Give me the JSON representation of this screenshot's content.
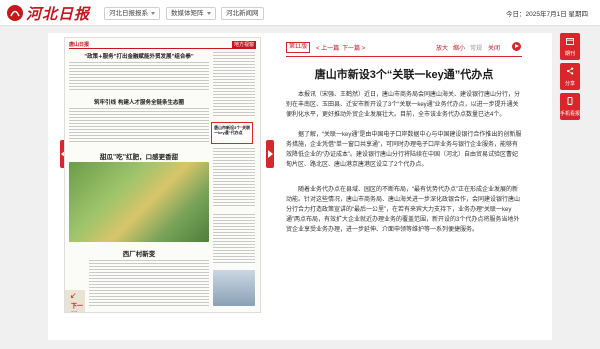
{
  "header": {
    "logo_text": "河北日报",
    "nav": [
      "河北日报报系",
      "数媒体矩阵",
      "河北新闻网"
    ],
    "date": "今日：2025年7月1日 星期四"
  },
  "newspaper": {
    "page_label": "唐山日报",
    "section_tag": "地方视窗",
    "headline_1": "\"政策+服务\"打出金融赋能外贸发展\"组合拳\"",
    "headline_2": "筑牢引线 构建人才服务全链条生态圈",
    "headline_3": "甜瓜\"吃\"红肥，口感更香甜",
    "headline_4": "西厂村新变",
    "highlight_title": "唐山市新设3个\"关联一key通\"代办点",
    "prev_page": "下一版"
  },
  "toolbar": {
    "edition": "第11版",
    "prev": "< 上一篇",
    "next": "下一篇 >",
    "zoom_in": "放大",
    "zoom_out": "缩小",
    "default": "常规",
    "close": "关闭"
  },
  "article": {
    "title": "唐山市新设3个“关联一key通”代办点",
    "paragraphs": [
      "本报讯（宋强、王鹤然）近日，唐山市商务局会同唐山海关、建设银行唐山分行，分别在丰南区、玉田县、迁安市新开设了3个“关联一key通”业务代办点，以进一步提升通关便利化水平，更好推动外贸企业发展壮大。目前，全市该业务代办点数量已达4个。",
      "据了解，“关联一key通”是由中国电子口岸数据中心与中国建设银行合作推出的创新服务措施，企业凭借“单一窗口共享通”，可同时办理电子口岸业务与银行企业服务，能够有效降低企业的“办证成本”。建设银行唐山分行将陆续在中国（河北）自由贸易试验区曹妃甸片区、路北区、唐山港京唐港区设立了2个代办点。",
      "随着业务代办点在县域、园区的不断布局，“最有优势代办点”正在形成企业发展的新动能。针对这些情况，唐山市商务局、唐山海关进一步深化政银合作，会同建设银行唐山分行合力打造政策宣讲的“最后一公里”，在若有来宾大力支持下，业务办理“关联一key通”两点布局，有效扩大企业就近办理业务的覆盖范围，新开设的3个代办点将服务当地外贸企业享受业务办理，进一步延伸、介面申领等维护等一系列便捷服务。"
    ]
  },
  "sidebar": {
    "items": [
      {
        "label": "期刊",
        "icon": "calendar-icon"
      },
      {
        "label": "分享",
        "icon": "share-icon"
      },
      {
        "label": "手机看报",
        "icon": "mobile-icon"
      }
    ]
  },
  "colors": {
    "accent": "#d9262c",
    "brand": "#c8161d"
  }
}
